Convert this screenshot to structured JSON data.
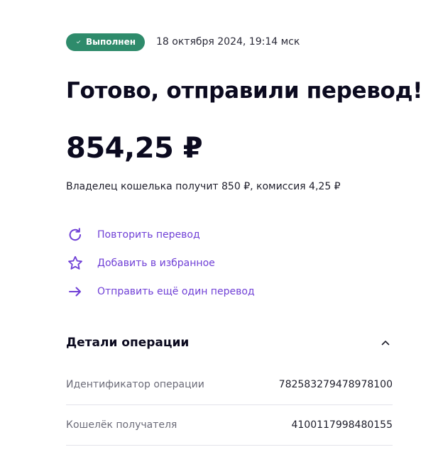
{
  "status": {
    "badge_label": "Выполнен",
    "date": "18 октября 2024, 19:14 мск",
    "badge_color": "#2e8b6b"
  },
  "headline": "Готово, отправили перевод!",
  "amount": "854,25 ₽",
  "summary": "Владелец кошелька получит 850 ₽, комиссия 4,25 ₽",
  "actions": [
    {
      "icon": "refresh-icon",
      "label": "Повторить перевод"
    },
    {
      "icon": "star-icon",
      "label": "Добавить в избранное"
    },
    {
      "icon": "arrow-right-icon",
      "label": "Отправить ещё один перевод"
    }
  ],
  "accent_color": "#6f3fd6",
  "details": {
    "title": "Детали операции",
    "expanded_icon": "chevron-up-icon",
    "rows": [
      {
        "label": "Идентификатор операции",
        "value": "782583279478978100"
      },
      {
        "label": "Кошелёк получателя",
        "value": "4100117998480155"
      }
    ]
  }
}
